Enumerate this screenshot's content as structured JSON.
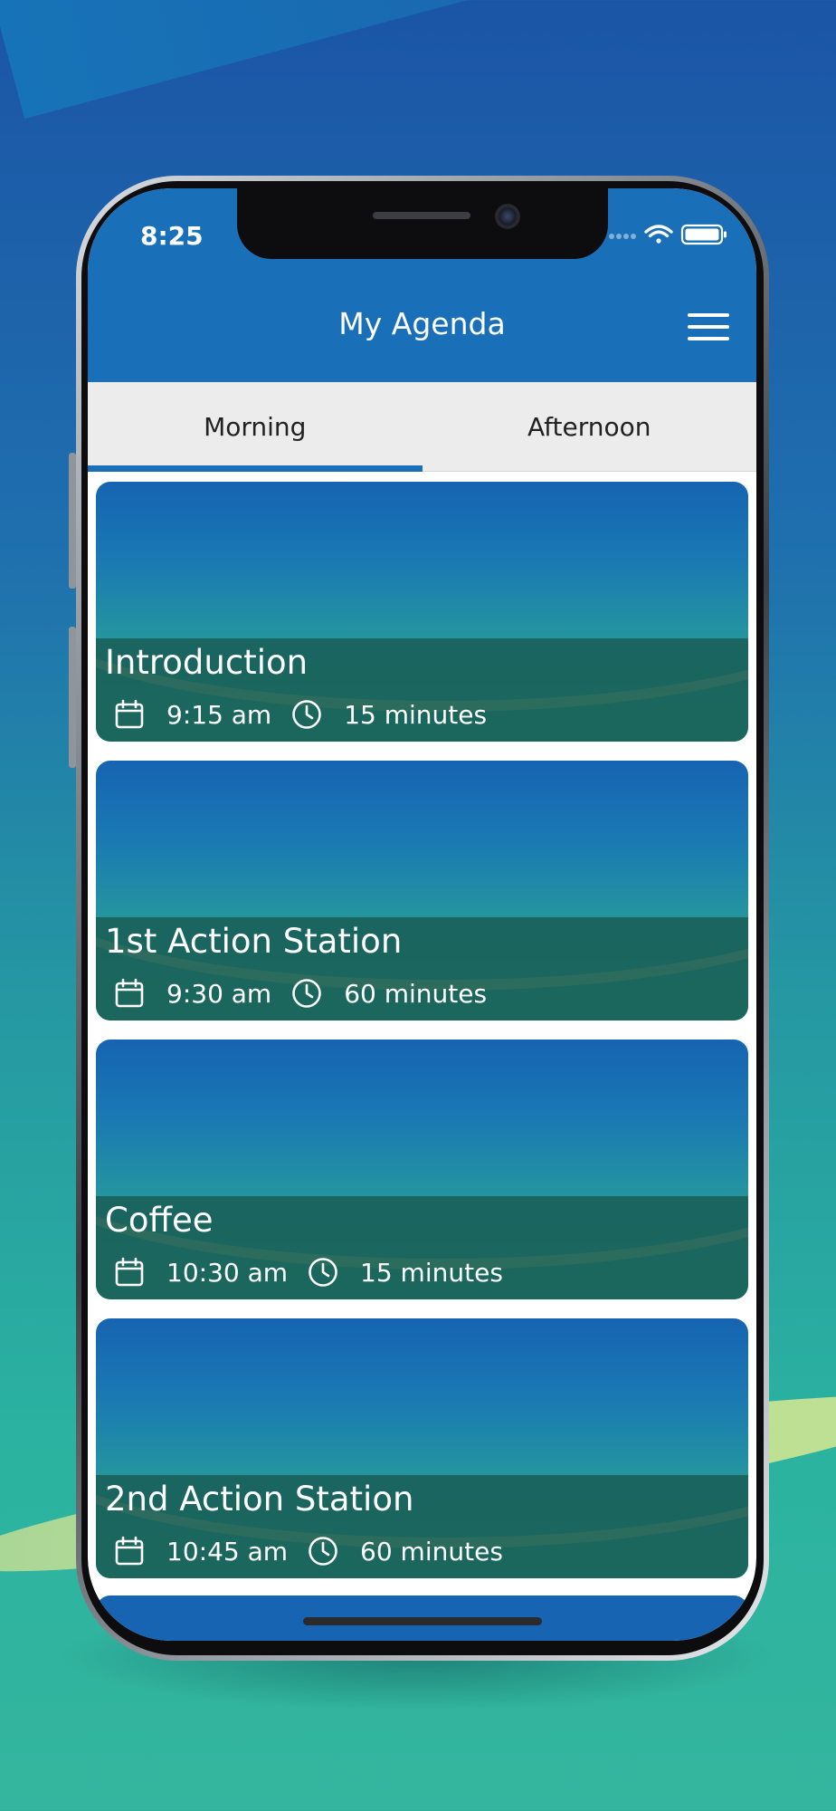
{
  "status_bar": {
    "time": "8:25"
  },
  "header": {
    "title": "My Agenda",
    "menu_icon": "hamburger-menu-icon"
  },
  "tabs": [
    {
      "label": "Morning",
      "active": true
    },
    {
      "label": "Afternoon",
      "active": false
    }
  ],
  "agenda": [
    {
      "title": "Introduction",
      "time": "9:15 am",
      "duration": "15 minutes"
    },
    {
      "title": "1st Action Station",
      "time": "9:30 am",
      "duration": "60 minutes"
    },
    {
      "title": "Coffee",
      "time": "10:30 am",
      "duration": "15 minutes"
    },
    {
      "title": "2nd Action Station",
      "time": "10:45 am",
      "duration": "60 minutes"
    }
  ],
  "colors": {
    "header": "#1a70b8",
    "tab_indicator": "#1a70b8",
    "card_overlay": "#185a50"
  }
}
